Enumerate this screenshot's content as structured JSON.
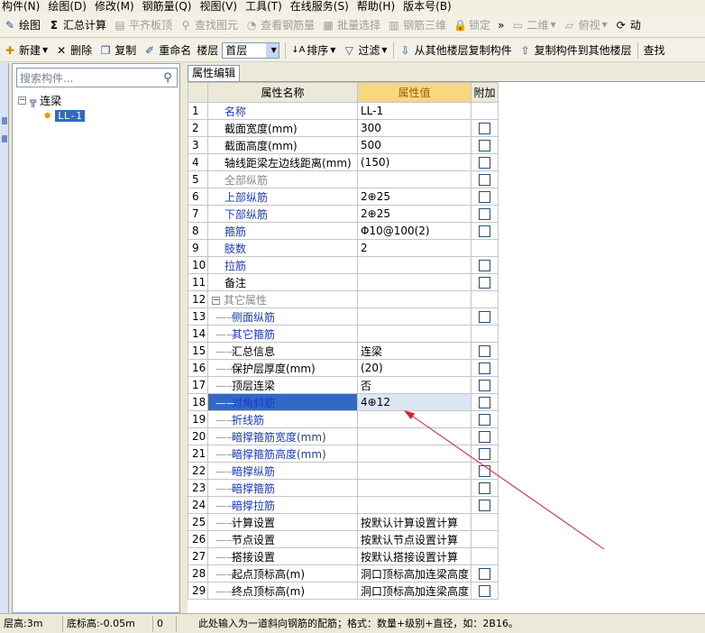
{
  "menu": [
    "构件(N)",
    "绘图(D)",
    "修改(M)",
    "钢筋量(Q)",
    "视图(V)",
    "工具(T)",
    "在线服务(S)",
    "帮助(H)",
    "版本号(B)"
  ],
  "toolbar1": {
    "draw": "绘图",
    "sum": "汇总计算",
    "flush_slab": "平齐板顶",
    "find_element": "查找图元",
    "view_rebar_qty": "查看钢筋量",
    "batch_select": "批量选择",
    "rebar_3d": "钢筋三维",
    "lock": "锁定",
    "overflow": "»",
    "view_2d": "二维",
    "view_top": "俯视",
    "dynamic": "动"
  },
  "toolbar2": {
    "new": "新建",
    "delete": "删除",
    "copy": "复制",
    "rename": "重命名",
    "floor_label": "楼层",
    "floor_value": "首层",
    "sort": "排序",
    "filter": "过滤",
    "copy_from_floor": "从其他楼层复制构件",
    "copy_to_floor": "复制构件到其他楼层",
    "find": "查找"
  },
  "tree": {
    "search_placeholder": "搜索构件...",
    "root": "连梁",
    "child": "LL-1"
  },
  "property_tab": "属性编辑",
  "table": {
    "headers": [
      "属性名称",
      "属性值",
      "附加"
    ],
    "rows": [
      {
        "num": "1",
        "name": "名称",
        "value": "LL-1",
        "color": "blue",
        "check": false
      },
      {
        "num": "2",
        "name": "截面宽度(mm)",
        "value": "300",
        "color": "black",
        "check": true
      },
      {
        "num": "3",
        "name": "截面高度(mm)",
        "value": "500",
        "color": "black",
        "check": true
      },
      {
        "num": "4",
        "name": "轴线距梁左边线距离(mm)",
        "value": "(150)",
        "color": "black",
        "check": true
      },
      {
        "num": "5",
        "name": "全部纵筋",
        "value": "",
        "color": "gray",
        "check": true
      },
      {
        "num": "6",
        "name": "上部纵筋",
        "value": "2⊕25",
        "color": "blue",
        "check": true
      },
      {
        "num": "7",
        "name": "下部纵筋",
        "value": "2⊕25",
        "color": "blue",
        "check": true
      },
      {
        "num": "8",
        "name": "箍筋",
        "value": "Φ10@100(2)",
        "color": "blue",
        "check": true
      },
      {
        "num": "9",
        "name": "肢数",
        "value": "2",
        "color": "blue",
        "check": false
      },
      {
        "num": "10",
        "name": "拉筋",
        "value": "",
        "color": "blue",
        "check": true
      },
      {
        "num": "11",
        "name": "备注",
        "value": "",
        "color": "black",
        "check": true
      },
      {
        "num": "12",
        "name": "其它属性",
        "value": "",
        "color": "gray",
        "check": false,
        "group": true
      },
      {
        "num": "13",
        "name": "侧面纵筋",
        "value": "",
        "color": "blue",
        "check": true,
        "child": true
      },
      {
        "num": "14",
        "name": "其它箍筋",
        "value": "",
        "color": "blue",
        "check": false,
        "child": true
      },
      {
        "num": "15",
        "name": "汇总信息",
        "value": "连梁",
        "color": "black",
        "check": true,
        "child": true
      },
      {
        "num": "16",
        "name": "保护层厚度(mm)",
        "value": "(20)",
        "color": "black",
        "check": true,
        "child": true
      },
      {
        "num": "17",
        "name": "顶层连梁",
        "value": "否",
        "color": "black",
        "check": true,
        "child": true
      },
      {
        "num": "18",
        "name": "对角斜筋",
        "value": "4⊕12",
        "color": "blue",
        "check": true,
        "child": true,
        "selected": true
      },
      {
        "num": "19",
        "name": "折线筋",
        "value": "",
        "color": "blue",
        "check": true,
        "child": true
      },
      {
        "num": "20",
        "name": "暗撑箍筋宽度(mm)",
        "value": "",
        "color": "blue",
        "check": true,
        "child": true
      },
      {
        "num": "21",
        "name": "暗撑箍筋高度(mm)",
        "value": "",
        "color": "blue",
        "check": true,
        "child": true
      },
      {
        "num": "22",
        "name": "暗撑纵筋",
        "value": "",
        "color": "blue",
        "check": true,
        "child": true
      },
      {
        "num": "23",
        "name": "暗撑箍筋",
        "value": "",
        "color": "blue",
        "check": true,
        "child": true
      },
      {
        "num": "24",
        "name": "暗撑拉筋",
        "value": "",
        "color": "blue",
        "check": true,
        "child": true
      },
      {
        "num": "25",
        "name": "计算设置",
        "value": "按默认计算设置计算",
        "color": "black",
        "check": false,
        "child": true
      },
      {
        "num": "26",
        "name": "节点设置",
        "value": "按默认节点设置计算",
        "color": "black",
        "check": false,
        "child": true
      },
      {
        "num": "27",
        "name": "搭接设置",
        "value": "按默认搭接设置计算",
        "color": "black",
        "check": false,
        "child": true
      },
      {
        "num": "28",
        "name": "起点顶标高(m)",
        "value": "洞口顶标高加连梁高度",
        "color": "black",
        "check": true,
        "child": true
      },
      {
        "num": "29",
        "name": "终点顶标高(m)",
        "value": "洞口顶标高加连梁高度",
        "color": "black",
        "check": true,
        "child": true
      }
    ]
  },
  "status": {
    "floor_height": "层高:3m",
    "bottom_elev": "底标高:-0.05m",
    "zero": "0",
    "hint": "此处输入为一道斜向钢筋的配筋；格式：数量+级别+直径，如：2B16。"
  },
  "colors": {
    "name_blue": "#1a3cc6",
    "header_highlight": "#f8d780",
    "selection": "#316ac5",
    "annotation_arrow": "#e0202a"
  }
}
